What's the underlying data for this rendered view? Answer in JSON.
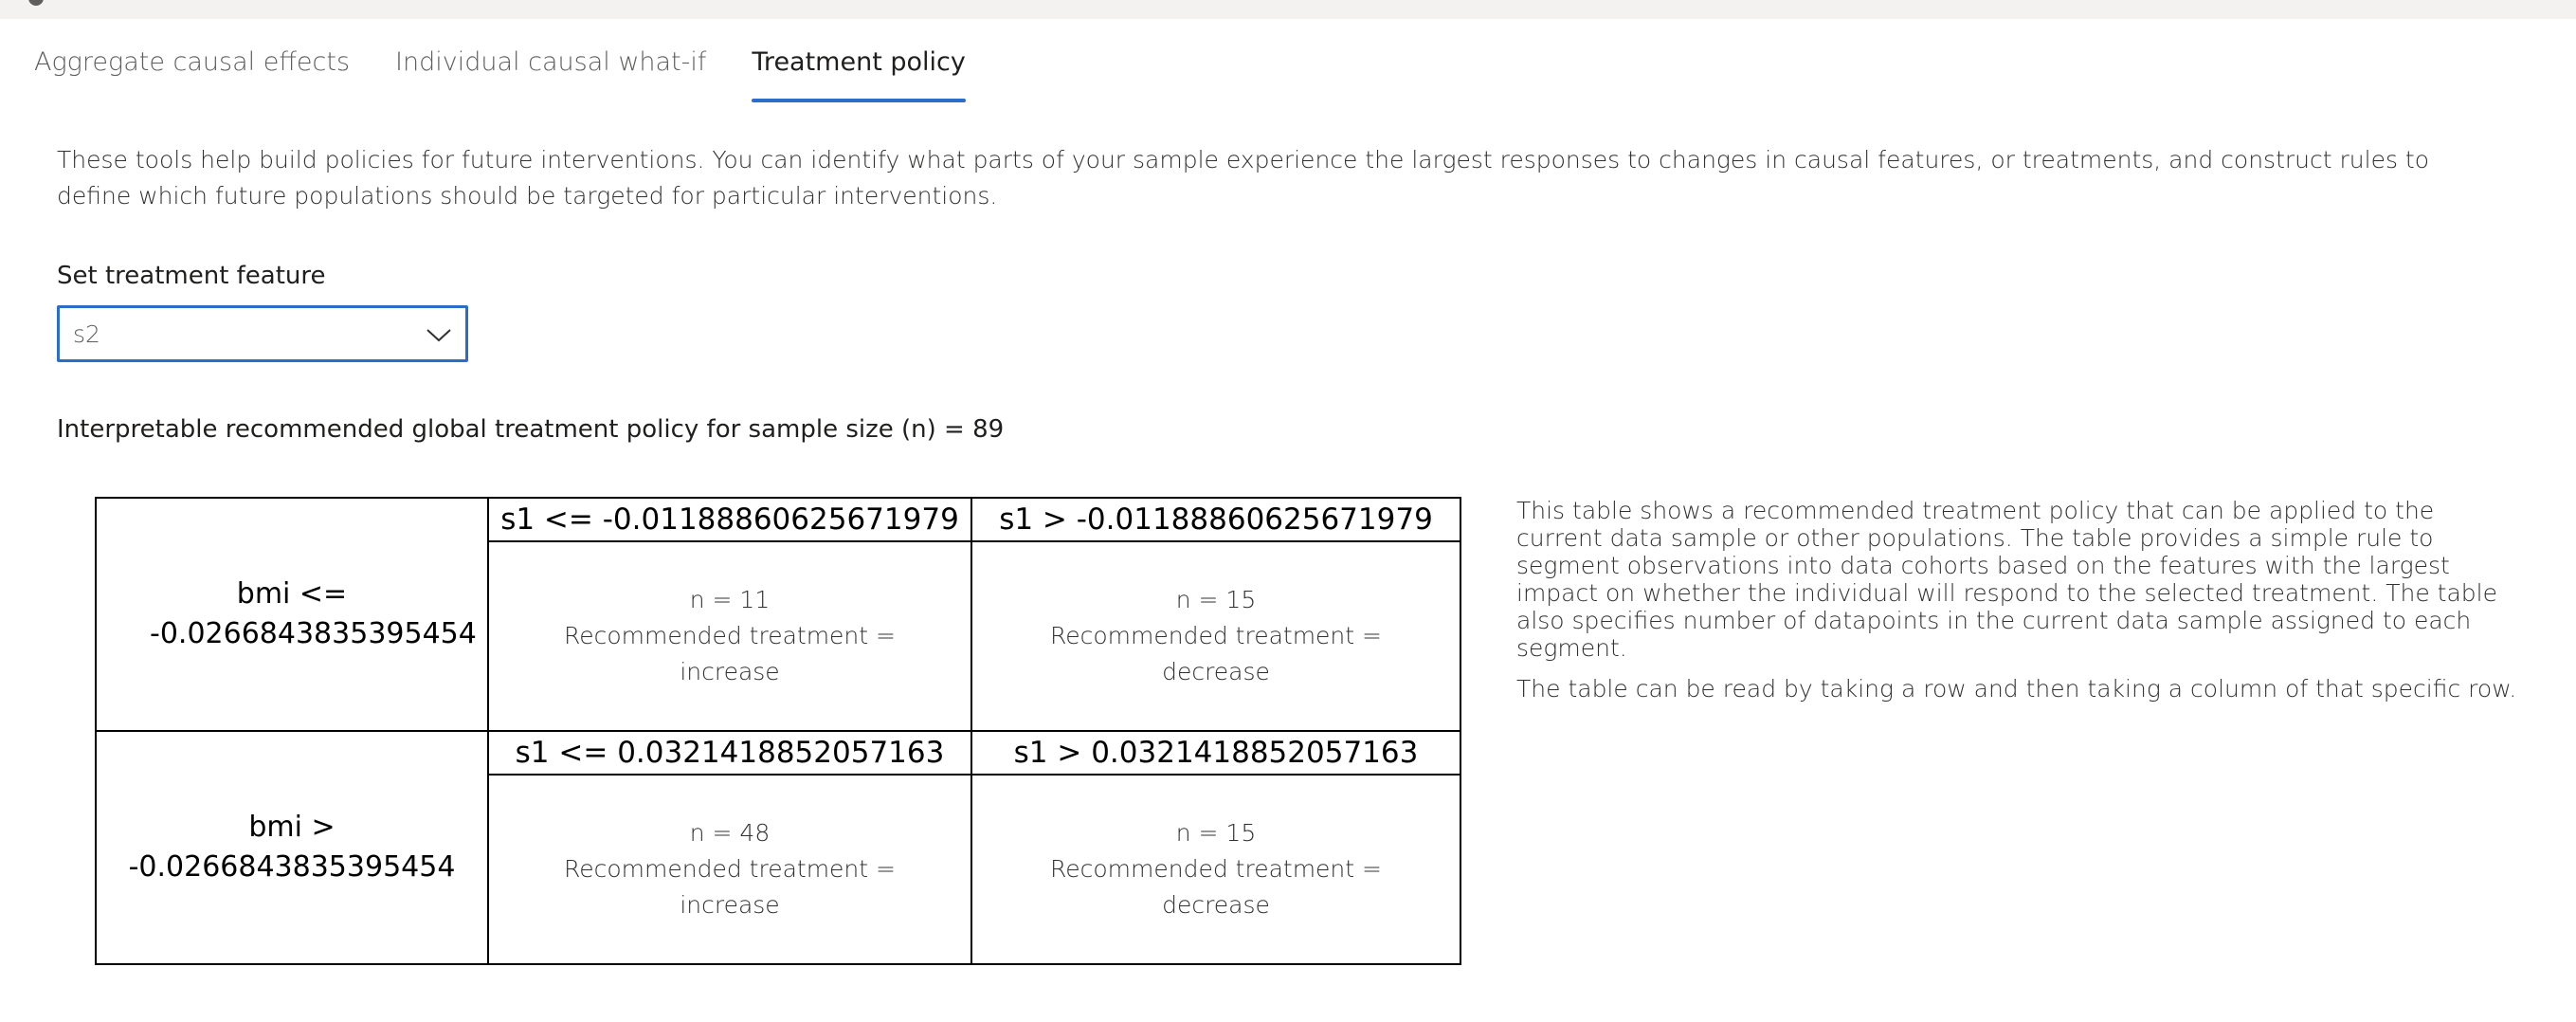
{
  "tabs": [
    {
      "label": "Aggregate causal effects",
      "active": false
    },
    {
      "label": "Individual causal what-if",
      "active": false
    },
    {
      "label": "Treatment policy",
      "active": true
    }
  ],
  "intro": "These tools help build policies for future interventions. You can identify what parts of your sample experience the largest responses to changes in causal features, or treatments, and construct rules to define which future populations should be targeted for particular interventions.",
  "treatment_feature": {
    "label": "Set treatment feature",
    "selected": "s2"
  },
  "policy": {
    "title": "Interpretable recommended global treatment policy for sample size (n) = 89",
    "rows": [
      {
        "header": "bmi <= -0.0266843835395454",
        "columns": [
          {
            "header": "s1 <= -0.01188860625671979",
            "n": "n = 11",
            "treatment_label": "Recommended treatment =",
            "treatment": "increase"
          },
          {
            "header": "s1 > -0.01188860625671979",
            "n": "n = 15",
            "treatment_label": "Recommended treatment =",
            "treatment": "decrease"
          }
        ]
      },
      {
        "header": "bmi > -0.0266843835395454",
        "columns": [
          {
            "header": "s1 <= 0.0321418852057163",
            "n": "n = 48",
            "treatment_label": "Recommended treatment =",
            "treatment": "increase"
          },
          {
            "header": "s1 > 0.0321418852057163",
            "n": "n = 15",
            "treatment_label": "Recommended treatment =",
            "treatment": "decrease"
          }
        ]
      }
    ]
  },
  "explanation": [
    "This table shows a recommended treatment policy that can be applied to the current data sample or other populations. The table provides a simple rule to segment observations into data cohorts based on the features with the largest impact on whether the individual will respond to the selected treatment. The table also specifies number of datapoints in the current data sample assigned to each segment.",
    "The table can be read by taking a row and then taking a column of that specific row."
  ],
  "icons": {
    "dropdown": "chevron-down-icon"
  },
  "colors": {
    "accent": "#2b6ec9",
    "border": "#000000"
  }
}
